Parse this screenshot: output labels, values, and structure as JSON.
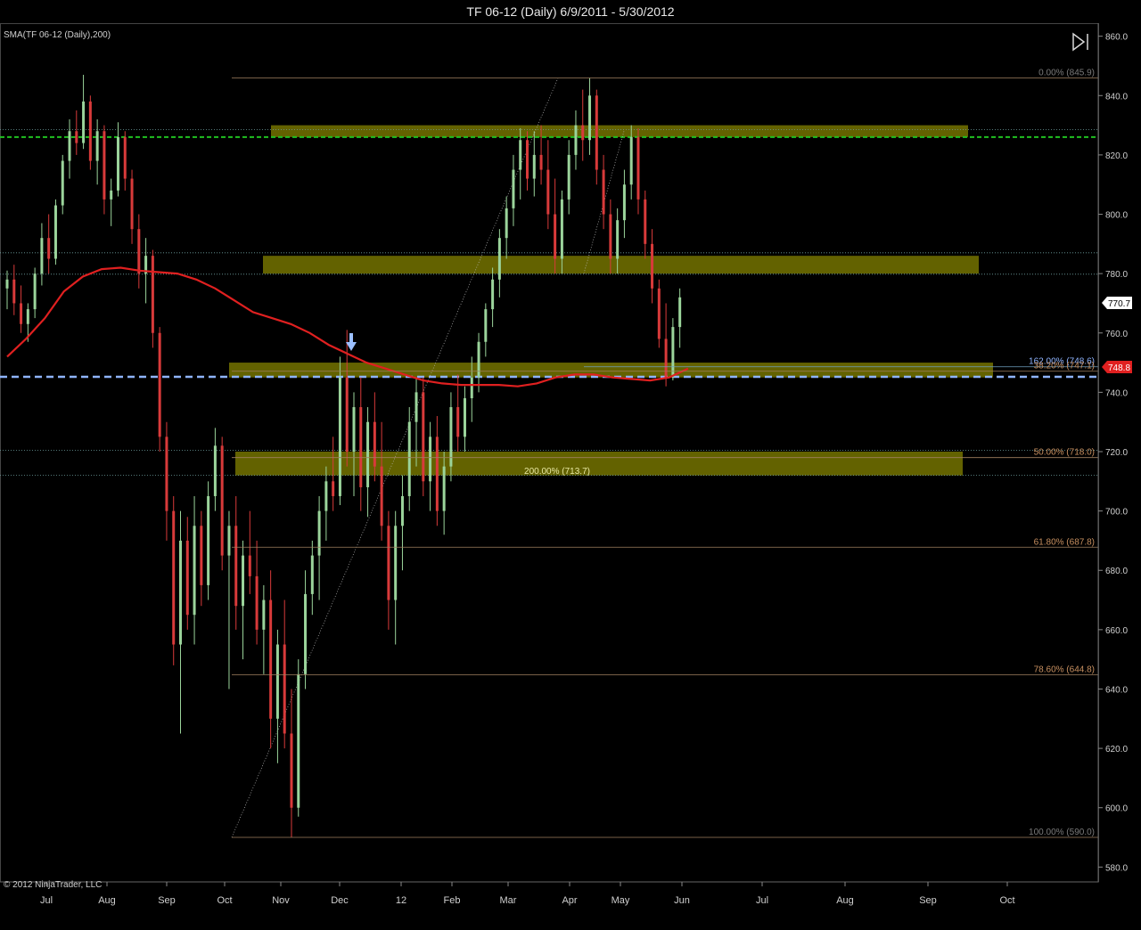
{
  "window": {
    "title": "TF 06-12 (Daily)  6/9/2011 - 5/30/2012"
  },
  "indicator_label": "SMA(TF 06-12 (Daily),200)",
  "copyright": "© 2012 NinjaTrader, LLC",
  "price_markers": {
    "last": "770.7",
    "sma": "748.8"
  },
  "colors": {
    "up_bar": "#9bd49b",
    "down_bar": "#d83a3a",
    "sma": "#e02020",
    "zone": "#6b6a00",
    "green_dash": "#20c020",
    "blue_dash": "#8fb4ff"
  },
  "icons": {
    "play_end": "skip-to-end-icon",
    "arrow": "down-arrow-icon"
  },
  "chart_data": {
    "type": "candlestick",
    "title": "TF 06-12 (Daily)  6/9/2011 - 5/30/2012",
    "y_axis": {
      "min": 575,
      "max": 862,
      "ticks": [
        "860.0",
        "840.0",
        "820.0",
        "800.0",
        "780.0",
        "760.0",
        "740.0",
        "720.0",
        "700.0",
        "680.0",
        "660.0",
        "640.0",
        "620.0",
        "600.0",
        "580.0"
      ],
      "side": "right"
    },
    "x_axis": {
      "labels": [
        "Jul",
        "Aug",
        "Sep",
        "Oct",
        "Nov",
        "Dec",
        "12",
        "Feb",
        "Mar",
        "Apr",
        "May",
        "Jun",
        "Jul",
        "Aug",
        "Sep",
        "Oct"
      ]
    },
    "fib_levels": [
      {
        "label": "0.00% (845.9)",
        "value": 845.9
      },
      {
        "label": "162.00% (748.6)",
        "value": 748.6
      },
      {
        "label": "38.20% (747.1)",
        "value": 747.1
      },
      {
        "label": "50.00% (718.0)",
        "value": 718.0
      },
      {
        "label": "200.00% (713.7)",
        "value": 713.7
      },
      {
        "label": "61.80% (687.8)",
        "value": 687.8
      },
      {
        "label": "78.60% (644.8)",
        "value": 644.8
      },
      {
        "label": "100.00% (590.0)",
        "value": 590.0
      }
    ],
    "zones": [
      {
        "low": 826,
        "high": 830
      },
      {
        "low": 780,
        "high": 786
      },
      {
        "low": 745,
        "high": 750
      },
      {
        "low": 712,
        "high": 720
      }
    ],
    "horizontal_lines": [
      {
        "value": 828.5,
        "style": "dotted"
      },
      {
        "value": 826.0,
        "style": "green-dash"
      },
      {
        "value": 787.0,
        "style": "dotted"
      },
      {
        "value": 779.8,
        "style": "dotted"
      },
      {
        "value": 720.5,
        "style": "dotted"
      },
      {
        "value": 712.0,
        "style": "dotted"
      },
      {
        "value": 745.2,
        "style": "blue-dash"
      }
    ],
    "sma_points": [
      [
        0,
        752
      ],
      [
        6,
        758
      ],
      [
        12,
        765
      ],
      [
        18,
        774
      ],
      [
        24,
        779
      ],
      [
        30,
        781.5
      ],
      [
        36,
        782
      ],
      [
        42,
        781
      ],
      [
        48,
        780.5
      ],
      [
        54,
        780
      ],
      [
        60,
        778
      ],
      [
        66,
        775
      ],
      [
        72,
        771
      ],
      [
        78,
        767
      ],
      [
        84,
        765
      ],
      [
        90,
        763
      ],
      [
        96,
        760
      ],
      [
        102,
        756
      ],
      [
        108,
        753
      ],
      [
        114,
        750
      ],
      [
        120,
        748
      ],
      [
        126,
        746
      ],
      [
        132,
        744
      ],
      [
        138,
        743
      ],
      [
        144,
        742.5
      ],
      [
        150,
        742.5
      ],
      [
        156,
        742.5
      ],
      [
        162,
        742
      ],
      [
        168,
        743
      ],
      [
        174,
        745
      ],
      [
        180,
        746
      ],
      [
        186,
        746
      ],
      [
        192,
        745
      ],
      [
        198,
        744.5
      ],
      [
        204,
        744
      ],
      [
        210,
        745
      ],
      [
        216,
        748
      ]
    ],
    "candles": [
      {
        "i": 0,
        "o": 775,
        "h": 781,
        "l": 768,
        "c": 778
      },
      {
        "i": 1,
        "o": 778,
        "h": 783,
        "l": 766,
        "c": 770
      },
      {
        "i": 2,
        "o": 770,
        "h": 776,
        "l": 760,
        "c": 763
      },
      {
        "i": 3,
        "o": 763,
        "h": 770,
        "l": 757,
        "c": 768
      },
      {
        "i": 4,
        "o": 768,
        "h": 782,
        "l": 765,
        "c": 780
      },
      {
        "i": 5,
        "o": 780,
        "h": 797,
        "l": 776,
        "c": 792
      },
      {
        "i": 6,
        "o": 792,
        "h": 800,
        "l": 780,
        "c": 785
      },
      {
        "i": 7,
        "o": 785,
        "h": 805,
        "l": 783,
        "c": 803
      },
      {
        "i": 8,
        "o": 803,
        "h": 820,
        "l": 800,
        "c": 818
      },
      {
        "i": 9,
        "o": 818,
        "h": 832,
        "l": 812,
        "c": 828
      },
      {
        "i": 10,
        "o": 828,
        "h": 835,
        "l": 820,
        "c": 824
      },
      {
        "i": 11,
        "o": 824,
        "h": 847,
        "l": 822,
        "c": 838
      },
      {
        "i": 12,
        "o": 838,
        "h": 840,
        "l": 815,
        "c": 818
      },
      {
        "i": 13,
        "o": 818,
        "h": 832,
        "l": 810,
        "c": 828
      },
      {
        "i": 14,
        "o": 828,
        "h": 830,
        "l": 800,
        "c": 805
      },
      {
        "i": 15,
        "o": 805,
        "h": 812,
        "l": 796,
        "c": 808
      },
      {
        "i": 16,
        "o": 808,
        "h": 831,
        "l": 806,
        "c": 826
      },
      {
        "i": 17,
        "o": 826,
        "h": 828,
        "l": 808,
        "c": 812
      },
      {
        "i": 18,
        "o": 812,
        "h": 815,
        "l": 790,
        "c": 795
      },
      {
        "i": 19,
        "o": 795,
        "h": 800,
        "l": 775,
        "c": 780
      },
      {
        "i": 20,
        "o": 780,
        "h": 792,
        "l": 770,
        "c": 786
      },
      {
        "i": 21,
        "o": 786,
        "h": 788,
        "l": 755,
        "c": 760
      },
      {
        "i": 22,
        "o": 760,
        "h": 762,
        "l": 720,
        "c": 725
      },
      {
        "i": 23,
        "o": 725,
        "h": 730,
        "l": 690,
        "c": 700
      },
      {
        "i": 24,
        "o": 700,
        "h": 705,
        "l": 648,
        "c": 655
      },
      {
        "i": 25,
        "o": 655,
        "h": 700,
        "l": 625,
        "c": 690
      },
      {
        "i": 26,
        "o": 690,
        "h": 698,
        "l": 660,
        "c": 665
      },
      {
        "i": 27,
        "o": 665,
        "h": 705,
        "l": 655,
        "c": 695
      },
      {
        "i": 28,
        "o": 695,
        "h": 700,
        "l": 668,
        "c": 675
      },
      {
        "i": 29,
        "o": 675,
        "h": 710,
        "l": 670,
        "c": 705
      },
      {
        "i": 30,
        "o": 705,
        "h": 728,
        "l": 700,
        "c": 722
      },
      {
        "i": 31,
        "o": 722,
        "h": 725,
        "l": 680,
        "c": 685
      },
      {
        "i": 32,
        "o": 685,
        "h": 700,
        "l": 640,
        "c": 695
      },
      {
        "i": 33,
        "o": 695,
        "h": 705,
        "l": 660,
        "c": 668
      },
      {
        "i": 34,
        "o": 668,
        "h": 690,
        "l": 650,
        "c": 685
      },
      {
        "i": 35,
        "o": 685,
        "h": 700,
        "l": 672,
        "c": 678
      },
      {
        "i": 36,
        "o": 678,
        "h": 690,
        "l": 655,
        "c": 660
      },
      {
        "i": 37,
        "o": 660,
        "h": 675,
        "l": 645,
        "c": 670
      },
      {
        "i": 38,
        "o": 670,
        "h": 680,
        "l": 620,
        "c": 630
      },
      {
        "i": 39,
        "o": 630,
        "h": 660,
        "l": 615,
        "c": 655
      },
      {
        "i": 40,
        "o": 655,
        "h": 670,
        "l": 620,
        "c": 625
      },
      {
        "i": 41,
        "o": 625,
        "h": 640,
        "l": 590,
        "c": 600
      },
      {
        "i": 42,
        "o": 600,
        "h": 650,
        "l": 597,
        "c": 645
      },
      {
        "i": 43,
        "o": 645,
        "h": 680,
        "l": 640,
        "c": 672
      },
      {
        "i": 44,
        "o": 672,
        "h": 690,
        "l": 665,
        "c": 685
      },
      {
        "i": 45,
        "o": 685,
        "h": 705,
        "l": 670,
        "c": 700
      },
      {
        "i": 46,
        "o": 700,
        "h": 715,
        "l": 690,
        "c": 710
      },
      {
        "i": 47,
        "o": 710,
        "h": 725,
        "l": 700,
        "c": 705
      },
      {
        "i": 48,
        "o": 705,
        "h": 752,
        "l": 702,
        "c": 745
      },
      {
        "i": 49,
        "o": 745,
        "h": 761,
        "l": 715,
        "c": 720
      },
      {
        "i": 50,
        "o": 720,
        "h": 740,
        "l": 705,
        "c": 735
      },
      {
        "i": 51,
        "o": 735,
        "h": 745,
        "l": 700,
        "c": 708
      },
      {
        "i": 52,
        "o": 708,
        "h": 735,
        "l": 698,
        "c": 730
      },
      {
        "i": 53,
        "o": 730,
        "h": 740,
        "l": 710,
        "c": 715
      },
      {
        "i": 54,
        "o": 715,
        "h": 730,
        "l": 690,
        "c": 695
      },
      {
        "i": 55,
        "o": 695,
        "h": 700,
        "l": 660,
        "c": 670
      },
      {
        "i": 56,
        "o": 670,
        "h": 700,
        "l": 655,
        "c": 695
      },
      {
        "i": 57,
        "o": 695,
        "h": 712,
        "l": 680,
        "c": 705
      },
      {
        "i": 58,
        "o": 705,
        "h": 735,
        "l": 700,
        "c": 730
      },
      {
        "i": 59,
        "o": 730,
        "h": 745,
        "l": 715,
        "c": 740
      },
      {
        "i": 60,
        "o": 740,
        "h": 745,
        "l": 705,
        "c": 710
      },
      {
        "i": 61,
        "o": 710,
        "h": 730,
        "l": 700,
        "c": 725
      },
      {
        "i": 62,
        "o": 725,
        "h": 732,
        "l": 695,
        "c": 700
      },
      {
        "i": 63,
        "o": 700,
        "h": 720,
        "l": 692,
        "c": 715
      },
      {
        "i": 64,
        "o": 715,
        "h": 740,
        "l": 710,
        "c": 735
      },
      {
        "i": 65,
        "o": 735,
        "h": 746,
        "l": 720,
        "c": 725
      },
      {
        "i": 66,
        "o": 725,
        "h": 742,
        "l": 720,
        "c": 738
      },
      {
        "i": 67,
        "o": 738,
        "h": 752,
        "l": 730,
        "c": 745
      },
      {
        "i": 68,
        "o": 745,
        "h": 760,
        "l": 740,
        "c": 757
      },
      {
        "i": 69,
        "o": 757,
        "h": 770,
        "l": 752,
        "c": 768
      },
      {
        "i": 70,
        "o": 768,
        "h": 782,
        "l": 762,
        "c": 778
      },
      {
        "i": 71,
        "o": 778,
        "h": 795,
        "l": 772,
        "c": 792
      },
      {
        "i": 72,
        "o": 792,
        "h": 806,
        "l": 785,
        "c": 802
      },
      {
        "i": 73,
        "o": 802,
        "h": 820,
        "l": 796,
        "c": 815
      },
      {
        "i": 74,
        "o": 815,
        "h": 829,
        "l": 805,
        "c": 825
      },
      {
        "i": 75,
        "o": 825,
        "h": 828,
        "l": 808,
        "c": 812
      },
      {
        "i": 76,
        "o": 812,
        "h": 828,
        "l": 806,
        "c": 820
      },
      {
        "i": 77,
        "o": 820,
        "h": 830,
        "l": 810,
        "c": 815
      },
      {
        "i": 78,
        "o": 815,
        "h": 825,
        "l": 795,
        "c": 800
      },
      {
        "i": 79,
        "o": 800,
        "h": 812,
        "l": 780,
        "c": 785
      },
      {
        "i": 80,
        "o": 785,
        "h": 808,
        "l": 780,
        "c": 805
      },
      {
        "i": 81,
        "o": 805,
        "h": 825,
        "l": 800,
        "c": 820
      },
      {
        "i": 82,
        "o": 820,
        "h": 835,
        "l": 815,
        "c": 830
      },
      {
        "i": 83,
        "o": 830,
        "h": 842,
        "l": 818,
        "c": 825
      },
      {
        "i": 84,
        "o": 825,
        "h": 846,
        "l": 820,
        "c": 840
      },
      {
        "i": 85,
        "o": 840,
        "h": 842,
        "l": 810,
        "c": 815
      },
      {
        "i": 86,
        "o": 815,
        "h": 820,
        "l": 795,
        "c": 800
      },
      {
        "i": 87,
        "o": 800,
        "h": 805,
        "l": 780,
        "c": 785
      },
      {
        "i": 88,
        "o": 785,
        "h": 802,
        "l": 780,
        "c": 798
      },
      {
        "i": 89,
        "o": 798,
        "h": 815,
        "l": 792,
        "c": 810
      },
      {
        "i": 90,
        "o": 810,
        "h": 830,
        "l": 805,
        "c": 826
      },
      {
        "i": 91,
        "o": 826,
        "h": 829,
        "l": 800,
        "c": 805
      },
      {
        "i": 92,
        "o": 805,
        "h": 808,
        "l": 785,
        "c": 790
      },
      {
        "i": 93,
        "o": 790,
        "h": 795,
        "l": 770,
        "c": 775
      },
      {
        "i": 94,
        "o": 775,
        "h": 778,
        "l": 755,
        "c": 758
      },
      {
        "i": 95,
        "o": 758,
        "h": 770,
        "l": 742,
        "c": 745
      },
      {
        "i": 96,
        "o": 745,
        "h": 765,
        "l": 744,
        "c": 762
      },
      {
        "i": 97,
        "o": 762,
        "h": 775,
        "l": 755,
        "c": 772
      }
    ]
  }
}
